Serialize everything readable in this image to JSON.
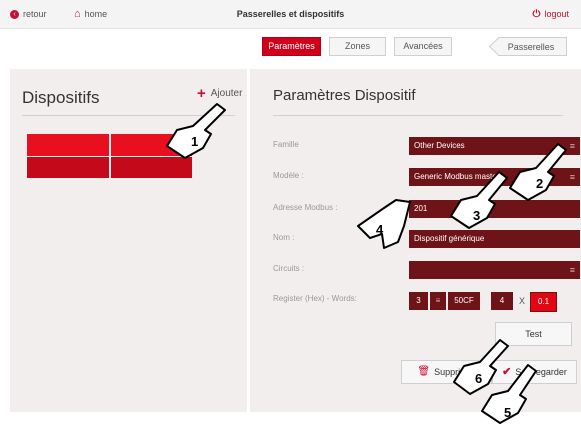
{
  "topbar": {
    "back_label": "retour",
    "home_label": "home",
    "title": "Passerelles et dispositifs",
    "logout_label": "logout"
  },
  "tabs": [
    {
      "label": "Paramètres",
      "active": true
    },
    {
      "label": "Zones",
      "active": false
    },
    {
      "label": "Avancées",
      "active": false
    }
  ],
  "back_tab_label": "Passerelles",
  "left": {
    "title": "Dispositifs",
    "add_label": "Ajouter"
  },
  "form": {
    "title": "Paramètres Dispositif",
    "famille_label": "Famille",
    "famille_value": "Other Devices",
    "modele_label": "Modèle :",
    "modele_value": "Generic Modbus master",
    "adresse_label": "Adresse Modbus :",
    "adresse_value": "201",
    "nom_label": "Nom :",
    "nom_value": "Dispositif générique",
    "circuits_label": "Circuits :",
    "circuits_value": "",
    "register_label": "Register (Hex) - Words:",
    "register_count": "3",
    "register_addr": "50CF",
    "words": "4",
    "x_label": "X",
    "scale": "0.1"
  },
  "buttons": {
    "test": "Test",
    "delete": "Supprimer",
    "save": "Sauvegarder"
  },
  "annotations": [
    "1",
    "2",
    "3",
    "4",
    "5",
    "6"
  ],
  "colors": {
    "accent": "#d0021b",
    "field": "#6e1317",
    "panel": "#f2eeee"
  }
}
